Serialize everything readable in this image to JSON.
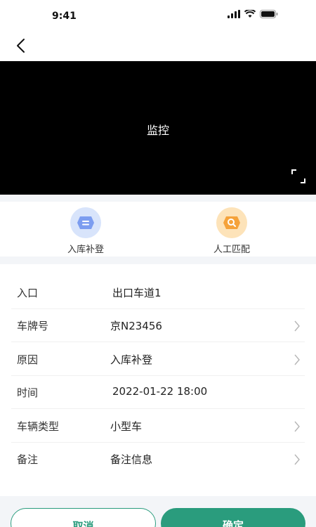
{
  "status_bar": {
    "time": "9:41"
  },
  "video": {
    "label": "监控"
  },
  "actions": [
    {
      "label": "入库补登",
      "icon": "entry-record-icon",
      "color": "#d8e4fb"
    },
    {
      "label": "人工匹配",
      "icon": "manual-match-icon",
      "color": "#fde3b9"
    }
  ],
  "form": {
    "rows": [
      {
        "label": "入口",
        "value": "出口车道1"
      },
      {
        "label": "车牌号",
        "value": "京N23456"
      },
      {
        "label": "原因",
        "value": "入库补登"
      },
      {
        "label": "时间",
        "value": "2022-01-22 18:00"
      },
      {
        "label": "车辆类型",
        "value": "小型车"
      },
      {
        "label": "备注",
        "value": "备注信息"
      }
    ]
  },
  "buttons": {
    "cancel": "取消",
    "confirm": "确定"
  },
  "colors": {
    "accent": "#2a9c7d",
    "blue_icon": "#7c9df0",
    "orange_icon": "#f5a23a"
  }
}
